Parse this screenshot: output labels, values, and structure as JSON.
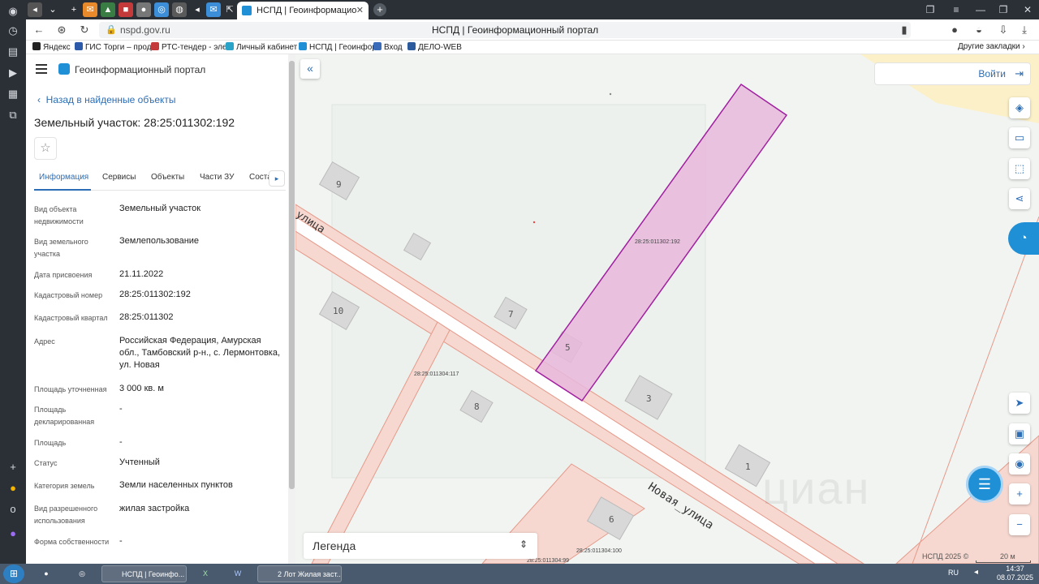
{
  "browser": {
    "tab_title": "НСПД | Геоинформацио",
    "url": "nspd.gov.ru",
    "page_title": "НСПД | Геоинформационный портал",
    "other_bookmarks": "Другие закладки",
    "bookmarks": [
      {
        "label": "Яндекс",
        "color": "#222222"
      },
      {
        "label": "ГИС Торги – прод",
        "color": "#2d5aa8"
      },
      {
        "label": "РТС-тендер - эле",
        "color": "#c43a3a"
      },
      {
        "label": "Личный кабинет",
        "color": "#2aa3c9"
      },
      {
        "label": "НСПД | Геоинфор",
        "color": "#1f8fd6"
      },
      {
        "label": "Вход",
        "color": "#3a6bb8"
      },
      {
        "label": "ДЕЛО-WEB",
        "color": "#2b5b9c"
      }
    ]
  },
  "panel": {
    "portal_name": "Геоинформационный портал",
    "back_link": "Назад в найденные объекты",
    "title": "Земельный участок: 28:25:011302:192",
    "tabs": [
      "Информация",
      "Сервисы",
      "Объекты",
      "Части ЗУ",
      "Соста"
    ],
    "rows": [
      {
        "label": "Вид объекта недвижимости",
        "value": "Земельный участок"
      },
      {
        "label": "Вид земельного участка",
        "value": "Землепользование"
      },
      {
        "label": "Дата присвоения",
        "value": "21.11.2022"
      },
      {
        "label": "Кадастровый номер",
        "value": "28:25:011302:192"
      },
      {
        "label": "Кадастровый квартал",
        "value": "28:25:011302"
      },
      {
        "label": "Адрес",
        "value": "Российская Федерация, Амурская обл., Тамбовский р-н., с. Лермонтовка, ул. Новая"
      },
      {
        "label": "Площадь уточненная",
        "value": "3 000 кв. м"
      },
      {
        "label": "Площадь декларированная",
        "value": "-"
      },
      {
        "label": "Площадь",
        "value": "-"
      },
      {
        "label": "Статус",
        "value": "Учтенный"
      },
      {
        "label": "Категория земель",
        "value": "Земли населенных пунктов"
      },
      {
        "label": "Вид разрешенного использования",
        "value": "жилая застройка"
      },
      {
        "label": "Форма собственности",
        "value": "-"
      }
    ]
  },
  "map": {
    "login": "Войти",
    "legend": "Легенда",
    "street": "Новая_улица",
    "street2": "улица",
    "copyright": "НСПД 2025 ©",
    "scale": "20 м",
    "watermark": "циан",
    "parcel_label": "28:25:011302:192",
    "cadastral_labels": [
      "28:25:011304:117",
      "28:25:011304:100",
      "28:25:011304:99"
    ],
    "building_numbers": [
      "9",
      "10",
      "7",
      "5",
      "8",
      "3",
      "1",
      "6"
    ],
    "colors": {
      "parcel_fill": "#e8b9dc",
      "parcel_stroke": "#a020a0",
      "road_stroke": "#e59a8a",
      "accent": "#1f8fd6"
    }
  },
  "taskbar": {
    "items": [
      "НСПД | Геоинфо...",
      "2 Лот Жилая заст..."
    ],
    "lang": "RU",
    "time": "14:37",
    "date": "08.07.2025"
  }
}
